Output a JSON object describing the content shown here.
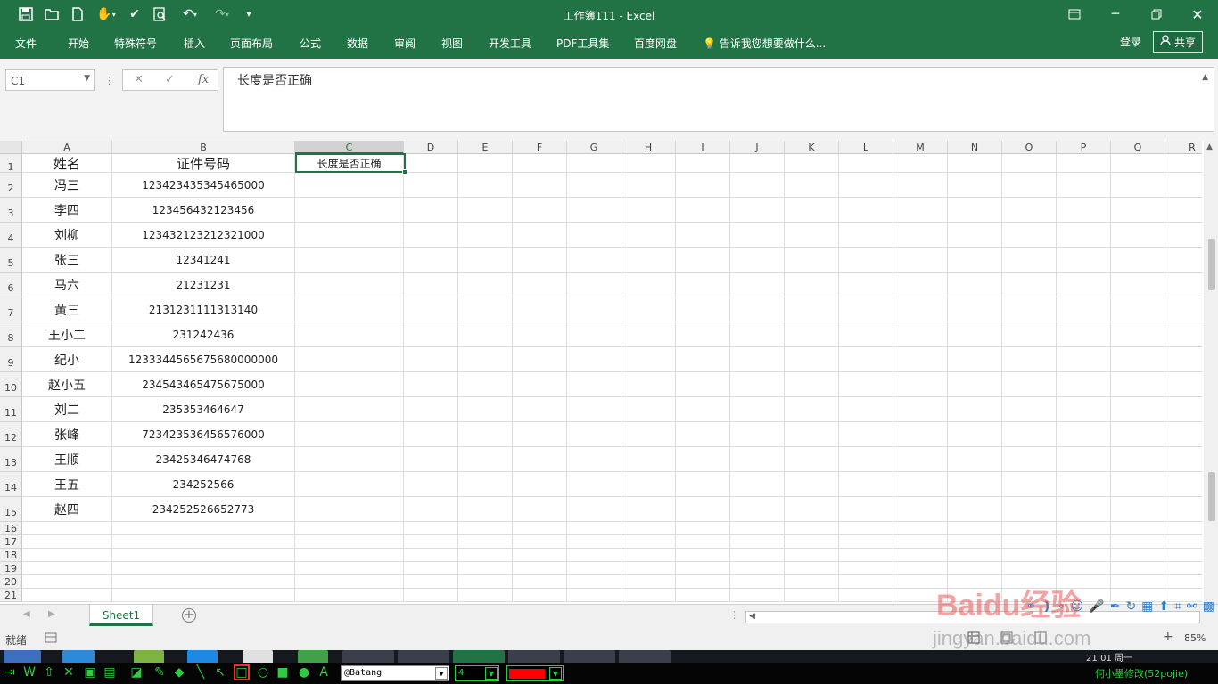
{
  "title_bar": {
    "document_title": "工作簿111 - Excel",
    "quick_access": [
      "save-icon",
      "open-icon",
      "new-icon",
      "touch-mode-icon",
      "spelling-icon",
      "print-preview-icon",
      "undo-icon",
      "redo-icon",
      "customize-icon"
    ],
    "window_controls": [
      "ribbon-display-icon",
      "minimize-icon",
      "restore-icon",
      "close-icon"
    ]
  },
  "menu": {
    "items": [
      "文件",
      "开始",
      "特殊符号",
      "插入",
      "页面布局",
      "公式",
      "数据",
      "审阅",
      "视图",
      "开发工具",
      "PDF工具集",
      "百度网盘"
    ],
    "tell_me": "告诉我您想要做什么...",
    "login": "登录",
    "share": "共享"
  },
  "formula_bar": {
    "name_box": "C1",
    "fx_label": "fx",
    "content": "长度是否正确"
  },
  "sheet": {
    "columns": [
      "A",
      "B",
      "C",
      "D",
      "E",
      "F",
      "G",
      "H",
      "I",
      "J",
      "K",
      "L",
      "M",
      "N",
      "O",
      "P",
      "Q",
      "R"
    ],
    "selected_column": "C",
    "selected_cell": "C1",
    "rows": [
      {
        "num": "1",
        "a": "姓名",
        "b": "证件号码",
        "c": "长度是否正确"
      },
      {
        "num": "2",
        "a": "冯三",
        "b": "123423435345465000",
        "c": ""
      },
      {
        "num": "3",
        "a": "李四",
        "b": "123456432123456",
        "c": ""
      },
      {
        "num": "4",
        "a": "刘柳",
        "b": "123432123212321000",
        "c": ""
      },
      {
        "num": "5",
        "a": "张三",
        "b": "12341241",
        "c": ""
      },
      {
        "num": "6",
        "a": "马六",
        "b": "21231231",
        "c": ""
      },
      {
        "num": "7",
        "a": "黄三",
        "b": "2131231111313140",
        "c": ""
      },
      {
        "num": "8",
        "a": "王小二",
        "b": "231242436",
        "c": ""
      },
      {
        "num": "9",
        "a": "纪小",
        "b": "1233344565675680000000",
        "c": ""
      },
      {
        "num": "10",
        "a": "赵小五",
        "b": "234543465475675000",
        "c": ""
      },
      {
        "num": "11",
        "a": "刘二",
        "b": "235353464647",
        "c": ""
      },
      {
        "num": "12",
        "a": "张峰",
        "b": "723423536456576000",
        "c": ""
      },
      {
        "num": "13",
        "a": "王顺",
        "b": "23425346474768",
        "c": ""
      },
      {
        "num": "14",
        "a": "王五",
        "b": "234252566",
        "c": ""
      },
      {
        "num": "15",
        "a": "赵四",
        "b": "234252526652773",
        "c": ""
      },
      {
        "num": "16",
        "a": "",
        "b": "",
        "c": ""
      },
      {
        "num": "17",
        "a": "",
        "b": "",
        "c": ""
      },
      {
        "num": "18",
        "a": "",
        "b": "",
        "c": ""
      },
      {
        "num": "19",
        "a": "",
        "b": "",
        "c": ""
      },
      {
        "num": "20",
        "a": "",
        "b": "",
        "c": ""
      },
      {
        "num": "21",
        "a": "",
        "b": "",
        "c": ""
      }
    ]
  },
  "tabs": {
    "sheet_name": "Sheet1",
    "add_symbol": "+"
  },
  "status": {
    "text": "就绪",
    "zoom": "85%"
  },
  "taskbar": {
    "clock": "21:01 周一"
  },
  "drawing_toolbar": {
    "font": "@Batang",
    "size": "4",
    "color": "#ff0000",
    "credit": "何小墨修改(52pojie)"
  },
  "watermark": {
    "logo": "Baidu经验",
    "url": "jingyan.baidu.com"
  },
  "colors": {
    "excel_green": "#217346",
    "grid_line": "#dcdcdc",
    "header_bg": "#f0f0f0"
  }
}
